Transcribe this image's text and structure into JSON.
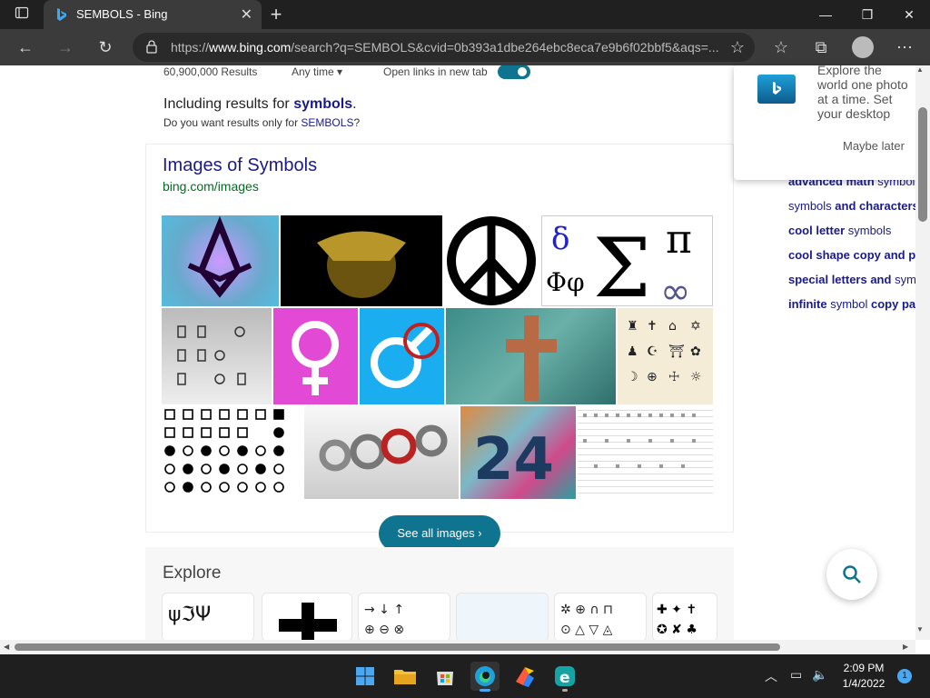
{
  "browser": {
    "tab_title": "SEMBOLS - Bing",
    "url_prefix": "https://",
    "url_host": "www.bing.com",
    "url_rest": "/search?q=SEMBOLS&cvid=0b393a1dbe264ebc8eca7e9b6f02bbf5&aqs=..."
  },
  "results_bar": {
    "count": "60,900,000 Results",
    "time_filter": "Any time",
    "open_links_label": "Open links in new tab",
    "open_links_on": true
  },
  "spell": {
    "including_prefix": "Including results for",
    "including_term": "symbols",
    "including_suffix": ".",
    "want_prefix": "Do you want results only for",
    "want_term": "SEMBOLS",
    "want_suffix": "?"
  },
  "images": {
    "title": "Images of Symbols",
    "source": "bing.com/images",
    "see_all": "See all images"
  },
  "explore": {
    "heading": "Explore"
  },
  "popup": {
    "text": "Explore the world one photo at a time. Set your desktop background to the Bing image of the day with Bing Wallpaper",
    "maybe_later": "Maybe later"
  },
  "related": [
    {
      "bold": "advanced math",
      "normal": " symbols"
    },
    {
      "normal": "symbols ",
      "bold": "and characters"
    },
    {
      "bold": "cool letter",
      "normal": " symbols"
    },
    {
      "bold": "cool shape copy and paste",
      "normal": ""
    },
    {
      "bold": "special letters and",
      "normal": " symbols"
    },
    {
      "bold": "infinite",
      "normal": " symbol ",
      "bold2": "copy paste"
    }
  ],
  "taskbar": {
    "time": "2:09 PM",
    "date": "1/4/2022",
    "notification_count": "1"
  },
  "colors": {
    "accent": "#0e7490",
    "link": "#1a0dab",
    "related_link": "#1a1a8a"
  }
}
